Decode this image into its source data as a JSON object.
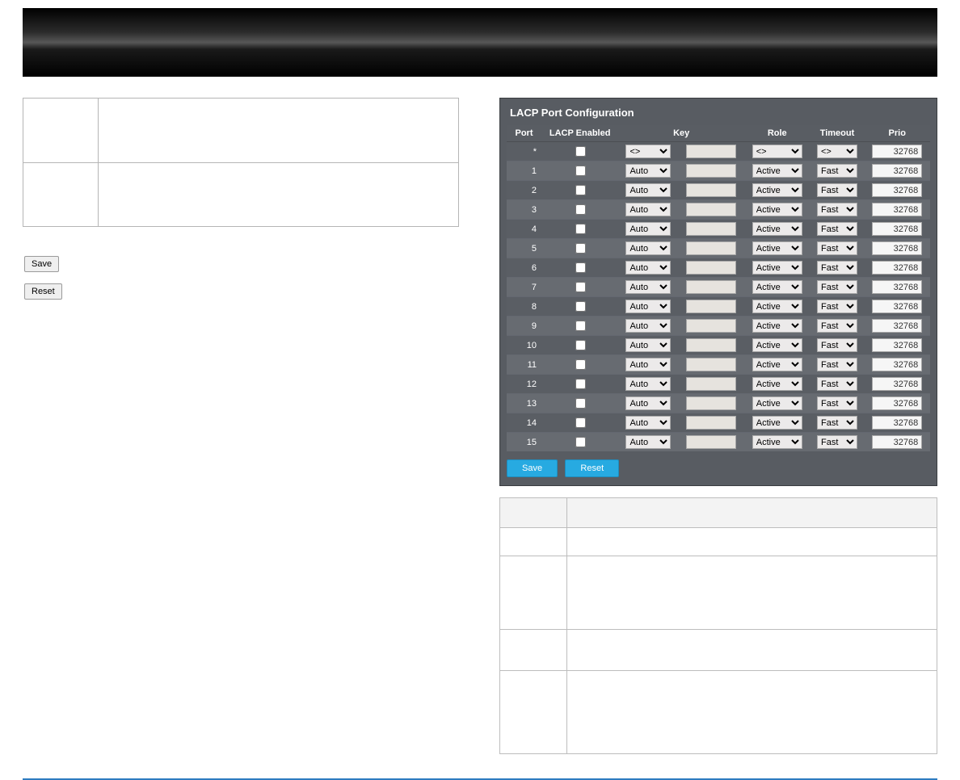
{
  "left": {
    "save_label": "Save",
    "reset_label": "Reset"
  },
  "panel": {
    "title": "LACP Port Configuration",
    "columns": [
      "Port",
      "LACP Enabled",
      "Key",
      "Role",
      "Timeout",
      "Prio"
    ],
    "wildcard": {
      "port": "*",
      "key_mode": "<>",
      "role": "<>",
      "timeout": "<>",
      "prio": "32768"
    },
    "rows": [
      {
        "port": "1",
        "key_mode": "Auto",
        "role": "Active",
        "timeout": "Fast",
        "prio": "32768"
      },
      {
        "port": "2",
        "key_mode": "Auto",
        "role": "Active",
        "timeout": "Fast",
        "prio": "32768"
      },
      {
        "port": "3",
        "key_mode": "Auto",
        "role": "Active",
        "timeout": "Fast",
        "prio": "32768"
      },
      {
        "port": "4",
        "key_mode": "Auto",
        "role": "Active",
        "timeout": "Fast",
        "prio": "32768"
      },
      {
        "port": "5",
        "key_mode": "Auto",
        "role": "Active",
        "timeout": "Fast",
        "prio": "32768"
      },
      {
        "port": "6",
        "key_mode": "Auto",
        "role": "Active",
        "timeout": "Fast",
        "prio": "32768"
      },
      {
        "port": "7",
        "key_mode": "Auto",
        "role": "Active",
        "timeout": "Fast",
        "prio": "32768"
      },
      {
        "port": "8",
        "key_mode": "Auto",
        "role": "Active",
        "timeout": "Fast",
        "prio": "32768"
      },
      {
        "port": "9",
        "key_mode": "Auto",
        "role": "Active",
        "timeout": "Fast",
        "prio": "32768"
      },
      {
        "port": "10",
        "key_mode": "Auto",
        "role": "Active",
        "timeout": "Fast",
        "prio": "32768"
      },
      {
        "port": "11",
        "key_mode": "Auto",
        "role": "Active",
        "timeout": "Fast",
        "prio": "32768"
      },
      {
        "port": "12",
        "key_mode": "Auto",
        "role": "Active",
        "timeout": "Fast",
        "prio": "32768"
      },
      {
        "port": "13",
        "key_mode": "Auto",
        "role": "Active",
        "timeout": "Fast",
        "prio": "32768"
      },
      {
        "port": "14",
        "key_mode": "Auto",
        "role": "Active",
        "timeout": "Fast",
        "prio": "32768"
      },
      {
        "port": "15",
        "key_mode": "Auto",
        "role": "Active",
        "timeout": "Fast",
        "prio": "32768"
      }
    ],
    "save_label": "Save",
    "reset_label": "Reset"
  }
}
